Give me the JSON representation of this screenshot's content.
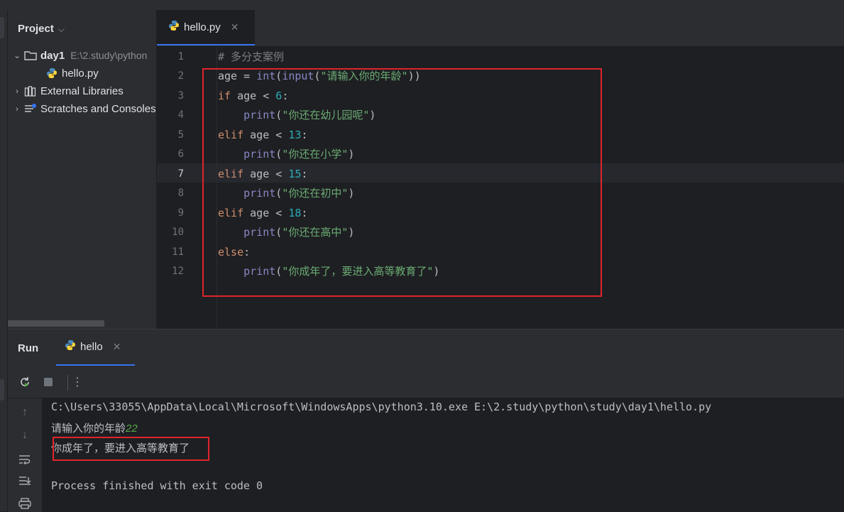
{
  "project_panel": {
    "title": "Project",
    "tree": [
      {
        "label": "day1",
        "path": "E:\\2.study\\python",
        "expanded": true
      },
      {
        "label": "hello.py"
      },
      {
        "label": "External Libraries"
      },
      {
        "label": "Scratches and Consoles"
      }
    ]
  },
  "editor": {
    "tab_label": "hello.py",
    "current_line": 7,
    "line_numbers": [
      "1",
      "2",
      "3",
      "4",
      "5",
      "6",
      "7",
      "8",
      "9",
      "10",
      "11",
      "12"
    ],
    "lines": [
      "# 多分支案例",
      "age = int(input(\"请输入你的年龄\"))",
      "if age < 6:",
      "    print(\"你还在幼儿园呢\")",
      "elif age < 13:",
      "    print(\"你还在小学\")",
      "elif age < 15:",
      "    print(\"你还在初中\")",
      "elif age < 18:",
      "    print(\"你还在高中\")",
      "else:",
      "    print(\"你成年了，要进入高等教育了\")"
    ]
  },
  "run_panel": {
    "title": "Run",
    "tab_label": "hello",
    "console": {
      "command": "C:\\Users\\33055\\AppData\\Local\\Microsoft\\WindowsApps\\python3.10.exe E:\\2.study\\python\\study\\day1\\hello.py",
      "prompt": "请输入你的年龄",
      "input_value": "22",
      "output": "你成年了，要进入高等教育了",
      "exit_message": "Process finished with exit code 0"
    }
  },
  "colors": {
    "background": "#1e1f22",
    "panel": "#2b2d30",
    "accent": "#3574f0",
    "highlight_box": "#e0242b",
    "keyword": "#cf8e6d",
    "string": "#6aab73",
    "number": "#2aacb8"
  },
  "icons": {
    "folder": "folder-icon",
    "python_file": "python-icon",
    "libraries": "library-icon",
    "scratches": "scratches-icon",
    "rerun": "rerun-icon",
    "stop": "stop-icon",
    "more": "more-vertical-icon",
    "scroll_up": "arrow-up-icon",
    "scroll_down": "arrow-down-icon",
    "soft_wrap": "soft-wrap-icon",
    "scroll_end": "scroll-to-end-icon",
    "print": "print-icon"
  }
}
